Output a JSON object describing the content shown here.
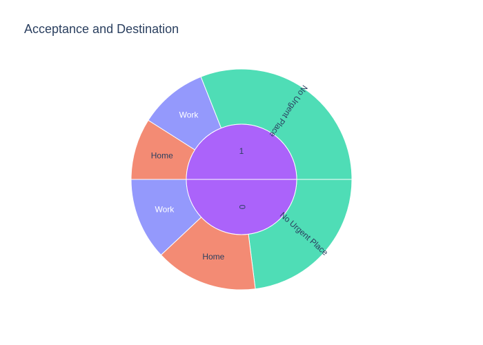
{
  "chart_data": {
    "type": "sunburst",
    "title": "Acceptance and Destination",
    "colors": {
      "No Urgent Place": "#4fddb6",
      "Home": "#f38b74",
      "Work": "#9499fc",
      "center": "#ab63fa"
    },
    "segments": [
      {
        "id": "0",
        "label": "0",
        "value": 50,
        "children": [
          {
            "id": "0-nup",
            "label": "No Urgent Place",
            "value": 23,
            "text_color": "dark"
          },
          {
            "id": "0-home",
            "label": "Home",
            "value": 15,
            "text_color": "dark"
          },
          {
            "id": "0-work",
            "label": "Work",
            "value": 12,
            "text_color": "light"
          }
        ]
      },
      {
        "id": "1",
        "label": "1",
        "value": 50,
        "children": [
          {
            "id": "1-home",
            "label": "Home",
            "value": 9,
            "text_color": "dark"
          },
          {
            "id": "1-work",
            "label": "Work",
            "value": 10,
            "text_color": "light"
          },
          {
            "id": "1-nup",
            "label": "No Urgent Place",
            "value": 31,
            "text_color": "dark"
          }
        ]
      }
    ]
  }
}
